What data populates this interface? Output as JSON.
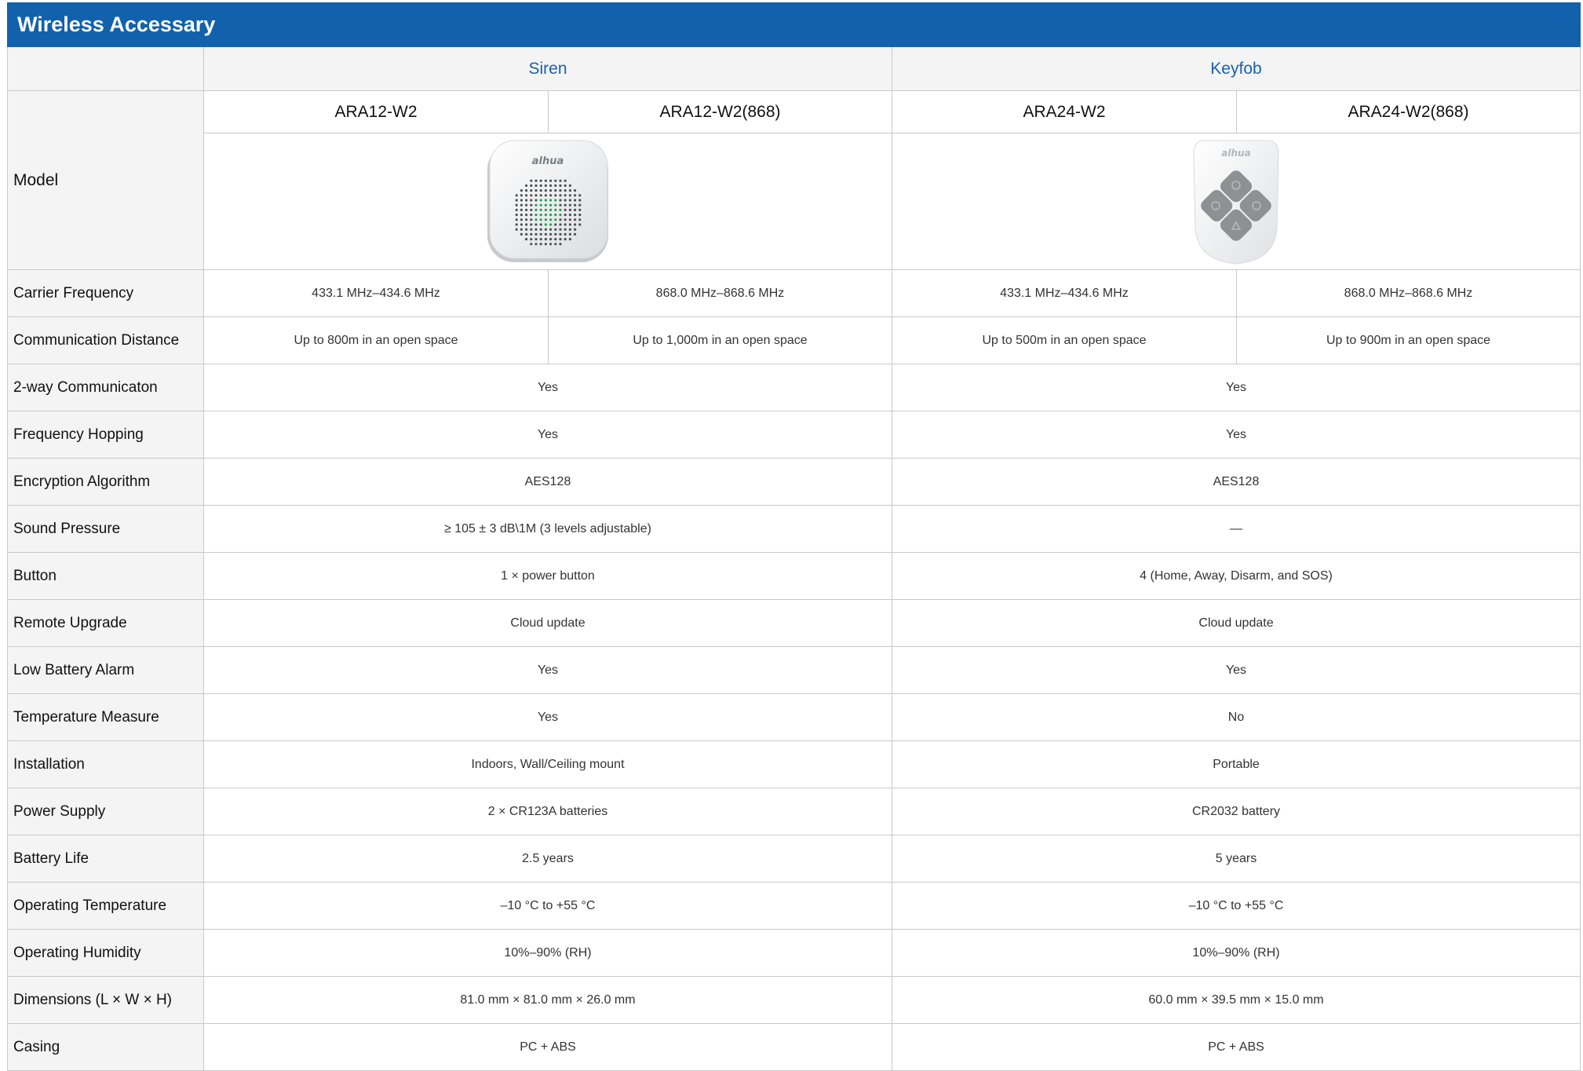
{
  "title": "Wireless Accessary",
  "categories": {
    "siren": "Siren",
    "keyfob": "Keyfob"
  },
  "model_label": "Model",
  "models": [
    "ARA12-W2",
    "ARA12-W2(868)",
    "ARA24-W2",
    "ARA24-W2(868)"
  ],
  "images": {
    "siren": {
      "icon": "siren-device-image",
      "brand": "alhua"
    },
    "keyfob": {
      "icon": "keyfob-device-image",
      "brand": "alhua"
    }
  },
  "split_rows": [
    {
      "label": "Carrier Frequency",
      "values": [
        "433.1 MHz–434.6 MHz",
        "868.0 MHz–868.6 MHz",
        "433.1 MHz–434.6 MHz",
        "868.0 MHz–868.6 MHz"
      ]
    },
    {
      "label": "Communication Distance",
      "values": [
        "Up to 800m in an open space",
        "Up to 1,000m in an open space",
        "Up to 500m in an open space",
        "Up to 900m in an open space"
      ]
    }
  ],
  "rows": [
    {
      "label": "2-way Communicaton",
      "siren": "Yes",
      "keyfob": "Yes"
    },
    {
      "label": "Frequency Hopping",
      "siren": "Yes",
      "keyfob": "Yes"
    },
    {
      "label": "Encryption Algorithm",
      "siren": "AES128",
      "keyfob": "AES128"
    },
    {
      "label": "Sound Pressure",
      "siren": "≥ 105 ± 3 dB\\1M (3 levels adjustable)",
      "keyfob": "—"
    },
    {
      "label": "Button",
      "siren": "1 × power button",
      "keyfob": "4 (Home, Away, Disarm, and SOS)"
    },
    {
      "label": "Remote Upgrade",
      "siren": "Cloud update",
      "keyfob": "Cloud update"
    },
    {
      "label": "Low Battery Alarm",
      "siren": "Yes",
      "keyfob": "Yes"
    },
    {
      "label": "Temperature Measure",
      "siren": "Yes",
      "keyfob": "No"
    },
    {
      "label": "Installation",
      "siren": "Indoors, Wall/Ceiling mount",
      "keyfob": "Portable"
    },
    {
      "label": "Power Supply",
      "siren": "2 × CR123A batteries",
      "keyfob": "CR2032 battery"
    },
    {
      "label": "Battery Life",
      "siren": "2.5 years",
      "keyfob": "5 years"
    },
    {
      "label": "Operating Temperature",
      "siren": "–10 °C to +55 °C",
      "keyfob": "–10 °C to +55 °C"
    },
    {
      "label": "Operating Humidity",
      "siren": "10%–90% (RH)",
      "keyfob": "10%–90% (RH)"
    },
    {
      "label": "Dimensions (L × W × H)",
      "siren": "81.0 mm × 81.0 mm × 26.0 mm",
      "keyfob": "60.0 mm × 39.5 mm × 15.0 mm"
    },
    {
      "label": "Casing",
      "siren": "PC + ABS",
      "keyfob": "PC + ABS"
    }
  ]
}
